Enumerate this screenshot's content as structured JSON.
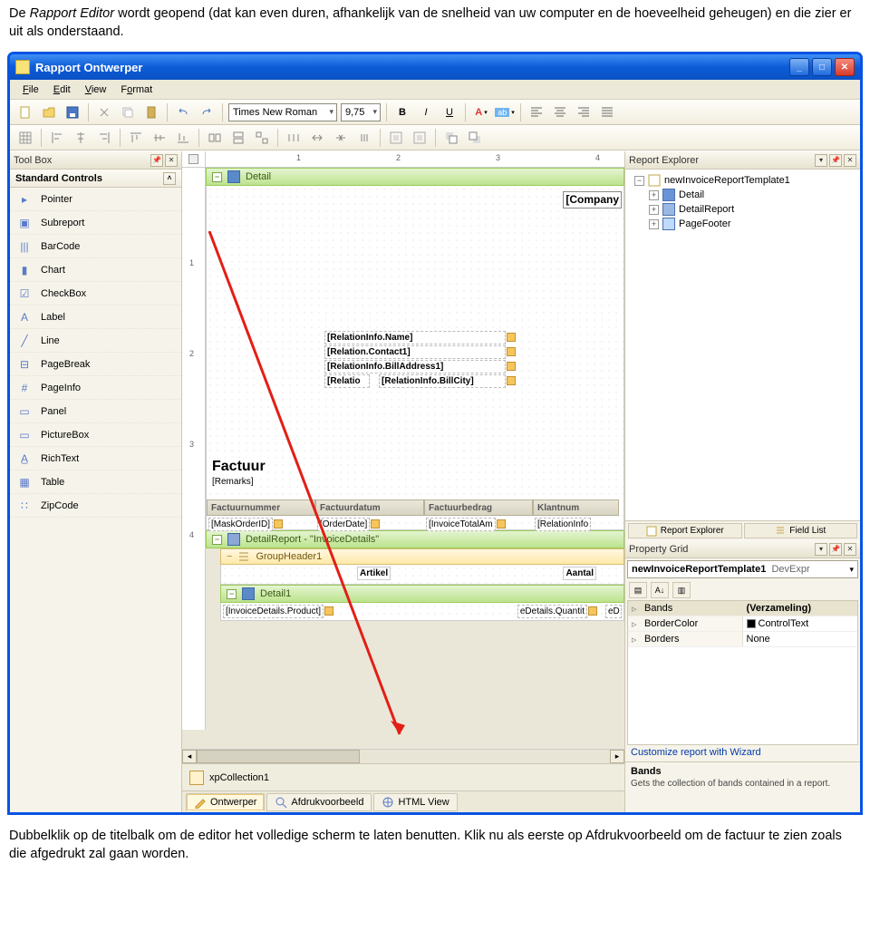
{
  "intro": {
    "line1a": "De ",
    "line1_italic": "Rapport Editor",
    "line1b": " wordt geopend (dat kan even duren, afhankelijk van de snelheid van uw computer en de hoeveelheid geheugen) en die zier er uit als onderstaand."
  },
  "window": {
    "title": "Rapport Ontwerper",
    "min": "_",
    "max": "□",
    "close": "✕"
  },
  "menu": {
    "file": "File",
    "edit": "Edit",
    "view": "View",
    "format": "Format"
  },
  "toolbar1": {
    "font_name": "Times New Roman",
    "font_size": "9,75",
    "bold": "B",
    "italic": "I",
    "underline": "U"
  },
  "toolbox": {
    "title": "Tool Box",
    "group": "Standard Controls",
    "items": [
      {
        "icon": "▸",
        "label": "Pointer"
      },
      {
        "icon": "▣",
        "label": "Subreport"
      },
      {
        "icon": "|||",
        "label": "BarCode"
      },
      {
        "icon": "▮",
        "label": "Chart"
      },
      {
        "icon": "☑",
        "label": "CheckBox"
      },
      {
        "icon": "A",
        "label": "Label"
      },
      {
        "icon": "╱",
        "label": "Line"
      },
      {
        "icon": "⊟",
        "label": "PageBreak"
      },
      {
        "icon": "#",
        "label": "PageInfo"
      },
      {
        "icon": "▭",
        "label": "Panel"
      },
      {
        "icon": "▭",
        "label": "PictureBox"
      },
      {
        "icon": "A̲",
        "label": "RichText"
      },
      {
        "icon": "▦",
        "label": "Table"
      },
      {
        "icon": "∷",
        "label": "ZipCode"
      }
    ]
  },
  "design": {
    "ruler_marks": [
      "1",
      "2",
      "3",
      "4"
    ],
    "vmarks": [
      "1",
      "2",
      "3",
      "4"
    ],
    "band_detail": "Detail",
    "company": "[Company",
    "fields": {
      "name": "[RelationInfo.Name]",
      "contact": "[Relation.Contact1]",
      "addr": "[RelationInfo.BillAddress1]",
      "relatio": "[Relatio",
      "city": "[RelationInfo.BillCity]"
    },
    "factuur": "Factuur",
    "remarks": "[Remarks]",
    "hdr": {
      "nummer": "Factuurnummer",
      "datum": "Factuurdatum",
      "bedrag": "Factuurbedrag",
      "klant": "Klantnum"
    },
    "vals": {
      "orderid": "[MaskOrderID]",
      "orderdate": "[OrderDate]",
      "total": "[InvoiceTotalAm",
      "relinfo": "[RelationInfo"
    },
    "detailreport": "DetailReport - \"InvoiceDetails\"",
    "groupheader": "GroupHeader1",
    "artikel": "Artikel",
    "aantal": "Aantal",
    "detail1": "Detail1",
    "product": "[InvoiceDetails.Product]",
    "qty": "eDetails.Quantit",
    "ed": "eD"
  },
  "component_tray": {
    "item": "xpCollection1"
  },
  "tabs": {
    "designer": "Ontwerper",
    "preview": "Afdrukvoorbeeld",
    "html": "HTML View"
  },
  "explorer": {
    "title": "Report Explorer",
    "root": "newInvoiceReportTemplate1",
    "nodes": [
      "Detail",
      "DetailReport",
      "PageFooter"
    ],
    "tab_explorer": "Report Explorer",
    "tab_fieldlist": "Field List"
  },
  "propgrid": {
    "title": "Property Grid",
    "selected_obj": "newInvoiceReportTemplate1",
    "selected_obj_type": "DevExpr",
    "rows": [
      {
        "name": "Bands",
        "val": "(Verzameling)",
        "bold": true
      },
      {
        "name": "BorderColor",
        "val": "ControlText",
        "color": "#000"
      },
      {
        "name": "Borders",
        "val": "None"
      }
    ],
    "link": "Customize report with Wizard",
    "desc_title": "Bands",
    "desc_text": "Gets the collection of bands contained in a report."
  },
  "outro": {
    "text_a": "Dubbelklik op de titelbalk om de editor het volledige scherm te laten benutten. Klik nu als eerste op ",
    "text_italic": "Afdrukvoorbeeld",
    "text_b": " om de factuur te zien zoals die afgedrukt zal gaan worden."
  }
}
